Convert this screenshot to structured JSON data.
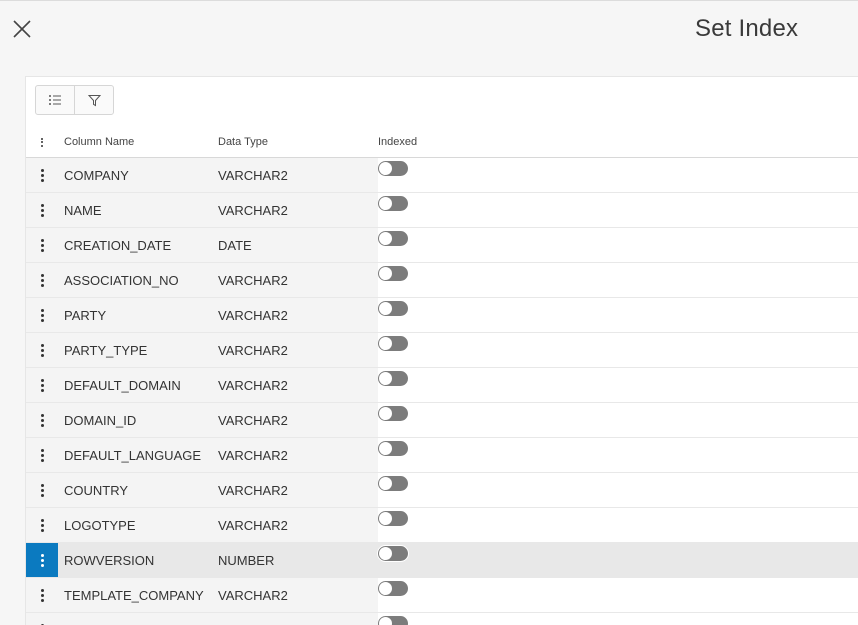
{
  "dialog": {
    "title": "Set Index"
  },
  "toolbar": {
    "list_icon": "list-icon",
    "filter_icon": "filter-icon"
  },
  "table": {
    "headers": {
      "column_name": "Column Name",
      "data_type": "Data Type",
      "indexed": "Indexed"
    },
    "rows": [
      {
        "column_name": "COMPANY",
        "data_type": "VARCHAR2",
        "indexed": false
      },
      {
        "column_name": "NAME",
        "data_type": "VARCHAR2",
        "indexed": false
      },
      {
        "column_name": "CREATION_DATE",
        "data_type": "DATE",
        "indexed": false
      },
      {
        "column_name": "ASSOCIATION_NO",
        "data_type": "VARCHAR2",
        "indexed": false
      },
      {
        "column_name": "PARTY",
        "data_type": "VARCHAR2",
        "indexed": false
      },
      {
        "column_name": "PARTY_TYPE",
        "data_type": "VARCHAR2",
        "indexed": false
      },
      {
        "column_name": "DEFAULT_DOMAIN",
        "data_type": "VARCHAR2",
        "indexed": false
      },
      {
        "column_name": "DOMAIN_ID",
        "data_type": "VARCHAR2",
        "indexed": false
      },
      {
        "column_name": "DEFAULT_LANGUAGE",
        "data_type": "VARCHAR2",
        "indexed": false
      },
      {
        "column_name": "COUNTRY",
        "data_type": "VARCHAR2",
        "indexed": false
      },
      {
        "column_name": "LOGOTYPE",
        "data_type": "VARCHAR2",
        "indexed": false
      },
      {
        "column_name": "ROWVERSION",
        "data_type": "NUMBER",
        "indexed": false,
        "selected": true
      },
      {
        "column_name": "TEMPLATE_COMPANY",
        "data_type": "VARCHAR2",
        "indexed": false
      },
      {
        "column_name": "",
        "data_type": "",
        "indexed": false
      }
    ]
  },
  "colors": {
    "selected_accent": "#0b7ac0",
    "toggle_off": "#7c7c7c"
  }
}
